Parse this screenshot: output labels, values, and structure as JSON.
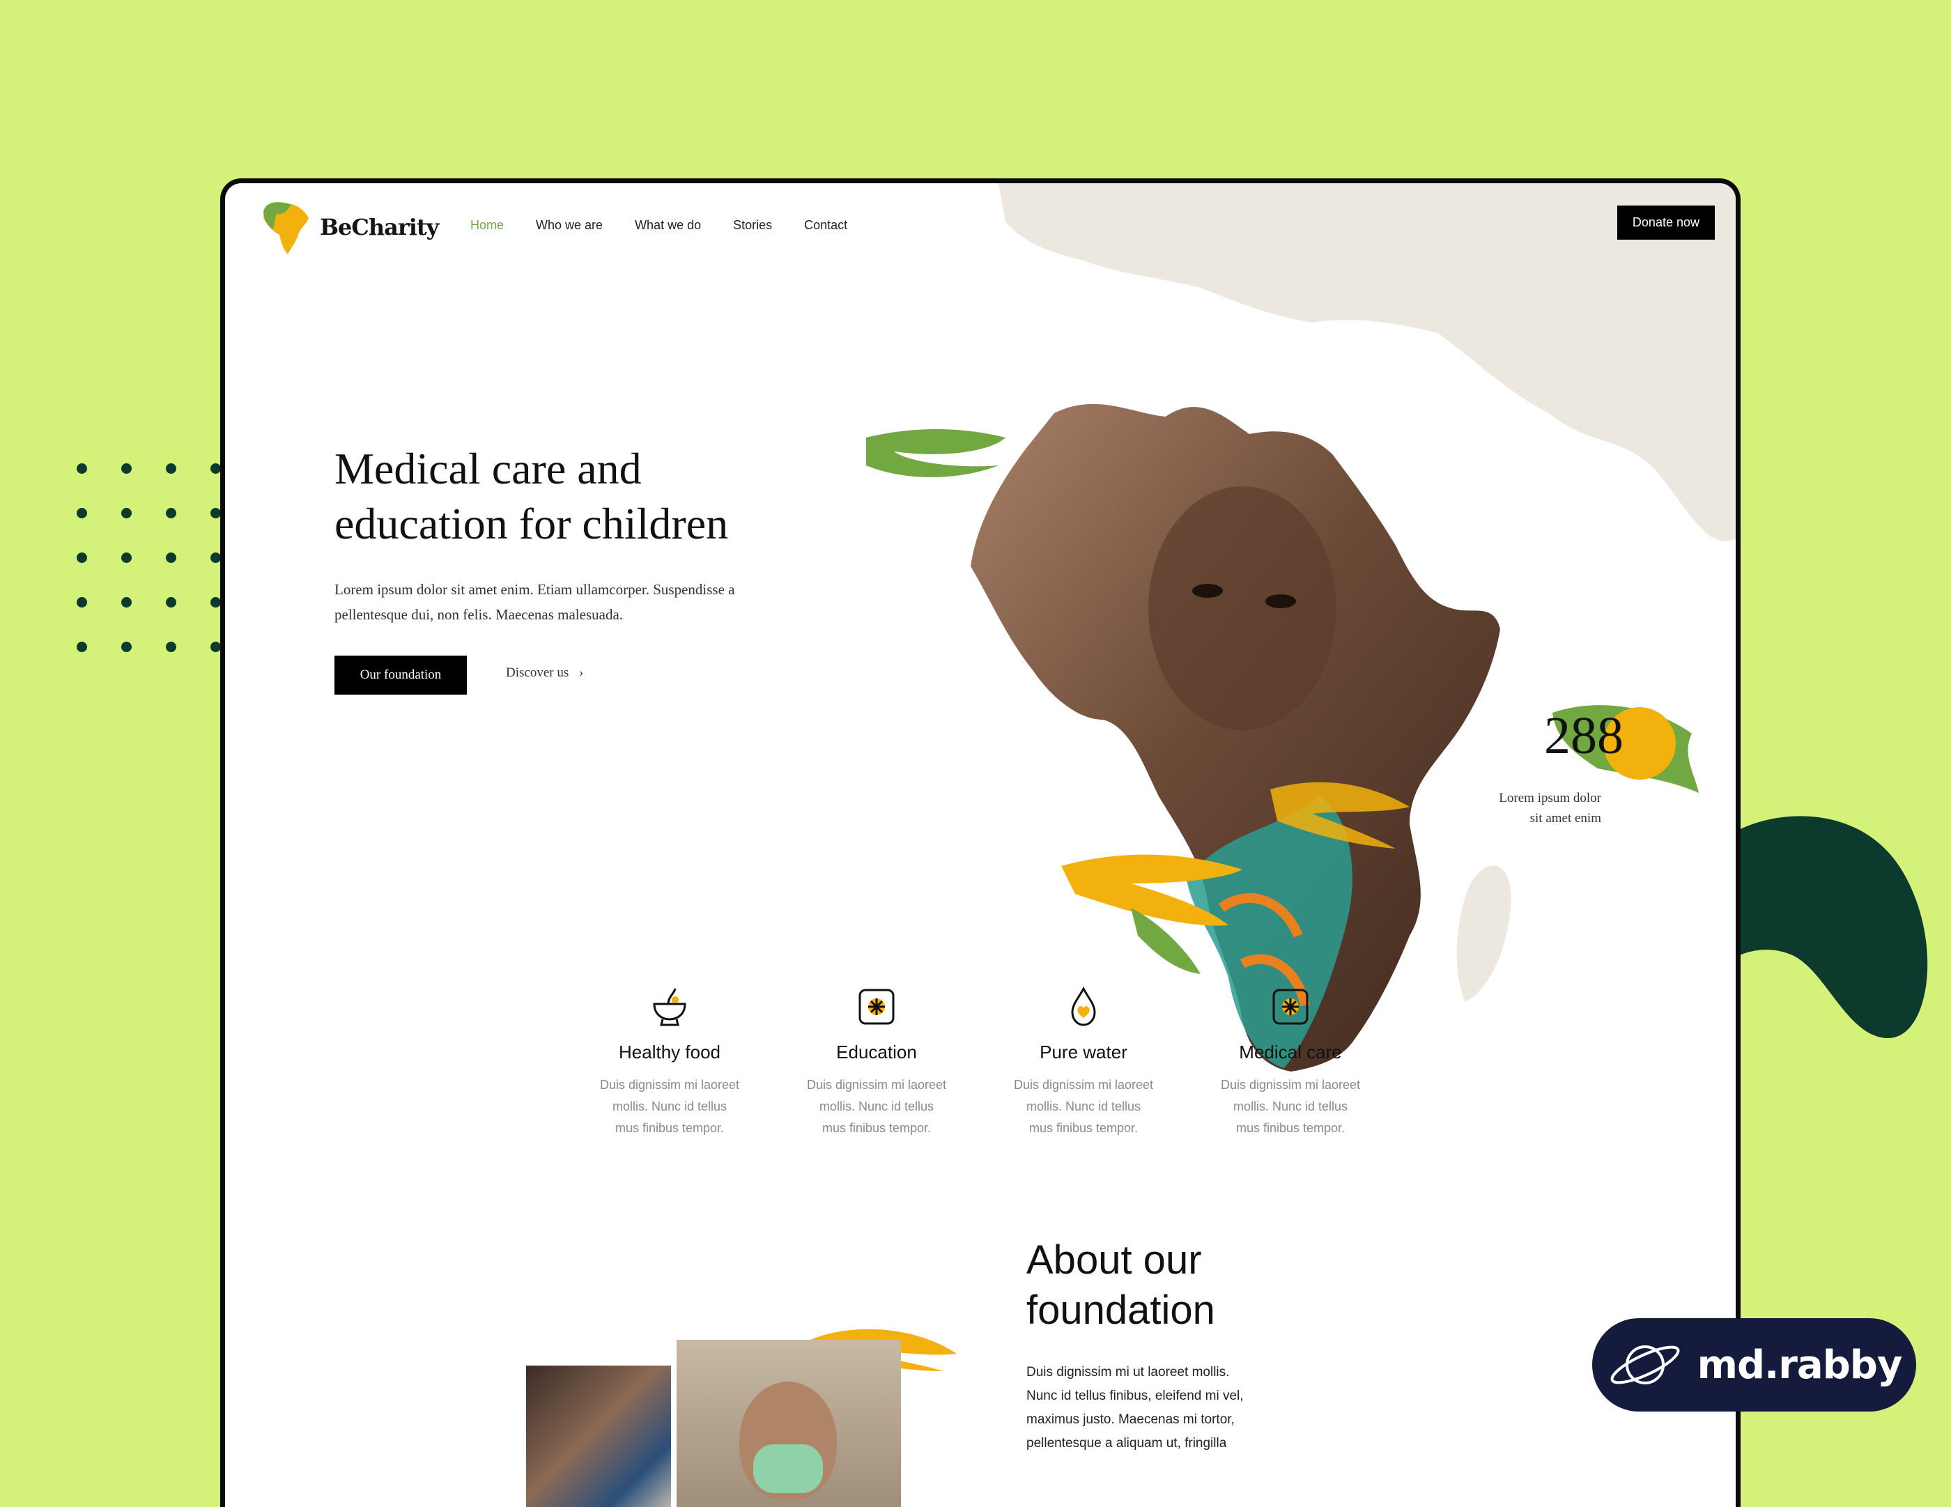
{
  "brand": {
    "name": "BeCharity",
    "badge": "md.rabby",
    "colors": {
      "background": "#d4f27a",
      "green": "#71a842",
      "yellow": "#f2b10c",
      "dark_green": "#0c3b2e",
      "badge_bg": "#151b3c"
    }
  },
  "nav": {
    "items": [
      {
        "label": "Home",
        "active": true
      },
      {
        "label": "Who we are",
        "active": false
      },
      {
        "label": "What we do",
        "active": false
      },
      {
        "label": "Stories",
        "active": false
      },
      {
        "label": "Contact",
        "active": false
      }
    ],
    "donate_label": "Donate now"
  },
  "hero": {
    "title_line1": "Medical care and",
    "title_line2": "education for children",
    "text_line1": "Lorem ipsum dolor sit amet enim. Etiam ullamcorper. Suspendisse a",
    "text_line2": "pellentesque dui, non felis. Maecenas malesuada.",
    "primary_button": "Our foundation",
    "link_label": "Discover us",
    "link_icon": "chevron-right-icon"
  },
  "stat": {
    "value": "288",
    "text_line1": "Lorem ipsum dolor",
    "text_line2": "sit amet enim"
  },
  "features": [
    {
      "icon": "bowl-icon",
      "title": "Healthy food",
      "l1": "Duis dignissim mi laoreet",
      "l2": "mollis. Nunc id tellus",
      "l3": "mus finibus tempor."
    },
    {
      "icon": "medical-badge-icon",
      "title": "Education",
      "l1": "Duis dignissim mi laoreet",
      "l2": "mollis. Nunc id tellus",
      "l3": "mus finibus tempor."
    },
    {
      "icon": "water-drop-heart-icon",
      "title": "Pure water",
      "l1": "Duis dignissim mi laoreet",
      "l2": "mollis. Nunc id tellus",
      "l3": "mus finibus tempor."
    },
    {
      "icon": "medical-badge-icon",
      "title": "Medical care",
      "l1": "Duis dignissim mi laoreet",
      "l2": "mollis. Nunc id tellus",
      "l3": "mus finibus tempor."
    }
  ],
  "about": {
    "title_line1": "About our",
    "title_line2": "foundation",
    "text_line1": "Duis dignissim mi ut laoreet mollis.",
    "text_line2": "Nunc id tellus finibus, eleifend mi vel,",
    "text_line3": "maximus justo. Maecenas mi tortor,",
    "text_line4": "pellentesque a aliquam ut, fringilla"
  }
}
